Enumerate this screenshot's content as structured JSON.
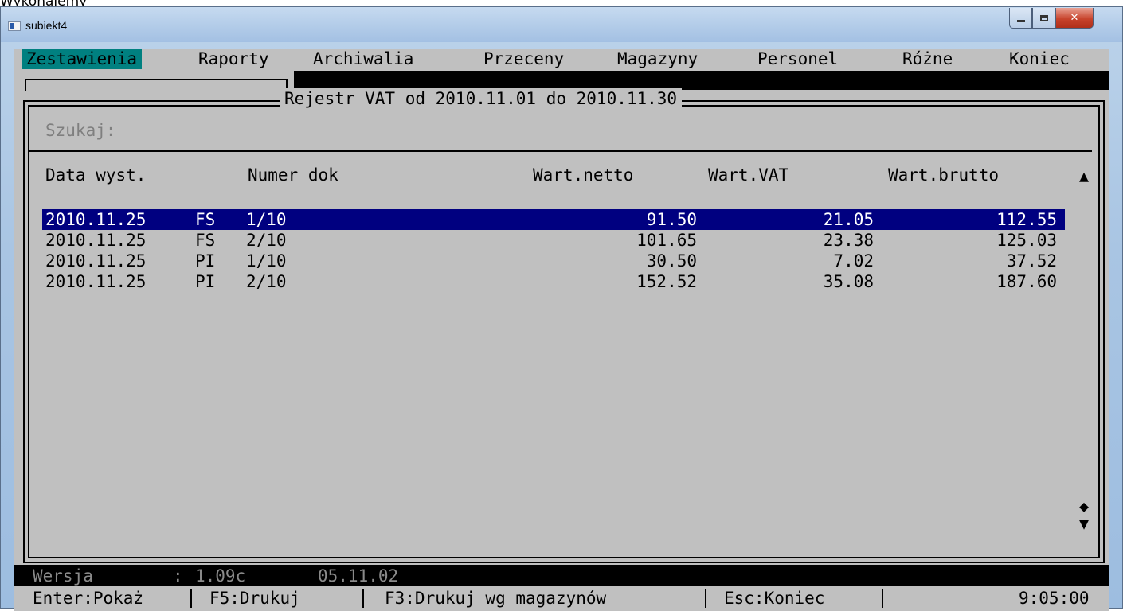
{
  "caption_fragment": "Wykonajemy",
  "window": {
    "title": "subiekt4"
  },
  "menu": [
    "Zestawienia",
    "Raporty",
    "Archiwalia",
    "Przeceny",
    "Magazyny",
    "Personel",
    "Różne",
    "Koniec"
  ],
  "frame": {
    "title": "Rejestr VAT od 2010.11.01 do 2010.11.30"
  },
  "search": {
    "label": "Szukaj:"
  },
  "columns": [
    "Data wyst.",
    "Numer dok",
    "Wart.netto",
    "Wart.VAT",
    "Wart.brutto"
  ],
  "rows": [
    {
      "date": "2010.11.25",
      "type": "FS",
      "num": "1/10",
      "netto": "91.50",
      "vat": "21.05",
      "brutto": "112.55",
      "selected": true
    },
    {
      "date": "2010.11.25",
      "type": "FS",
      "num": "2/10",
      "netto": "101.65",
      "vat": "23.38",
      "brutto": "125.03"
    },
    {
      "date": "2010.11.25",
      "type": "PI",
      "num": "1/10",
      "netto": "30.50",
      "vat": "7.02",
      "brutto": "37.52"
    },
    {
      "date": "2010.11.25",
      "type": "PI",
      "num": "2/10",
      "netto": "152.52",
      "vat": "35.08",
      "brutto": "187.60"
    }
  ],
  "status": {
    "label": "Wersja",
    "sep": ":",
    "version": "1.09c",
    "date": "05.11.02"
  },
  "fkeys": [
    "Enter:Pokaż",
    "F5:Drukuj",
    "F3:Drukuj wg magazynów",
    "Esc:Koniec"
  ],
  "clock": "9:05:00",
  "icons": {
    "up": "▲",
    "thumb": "◆",
    "down": "▼"
  }
}
